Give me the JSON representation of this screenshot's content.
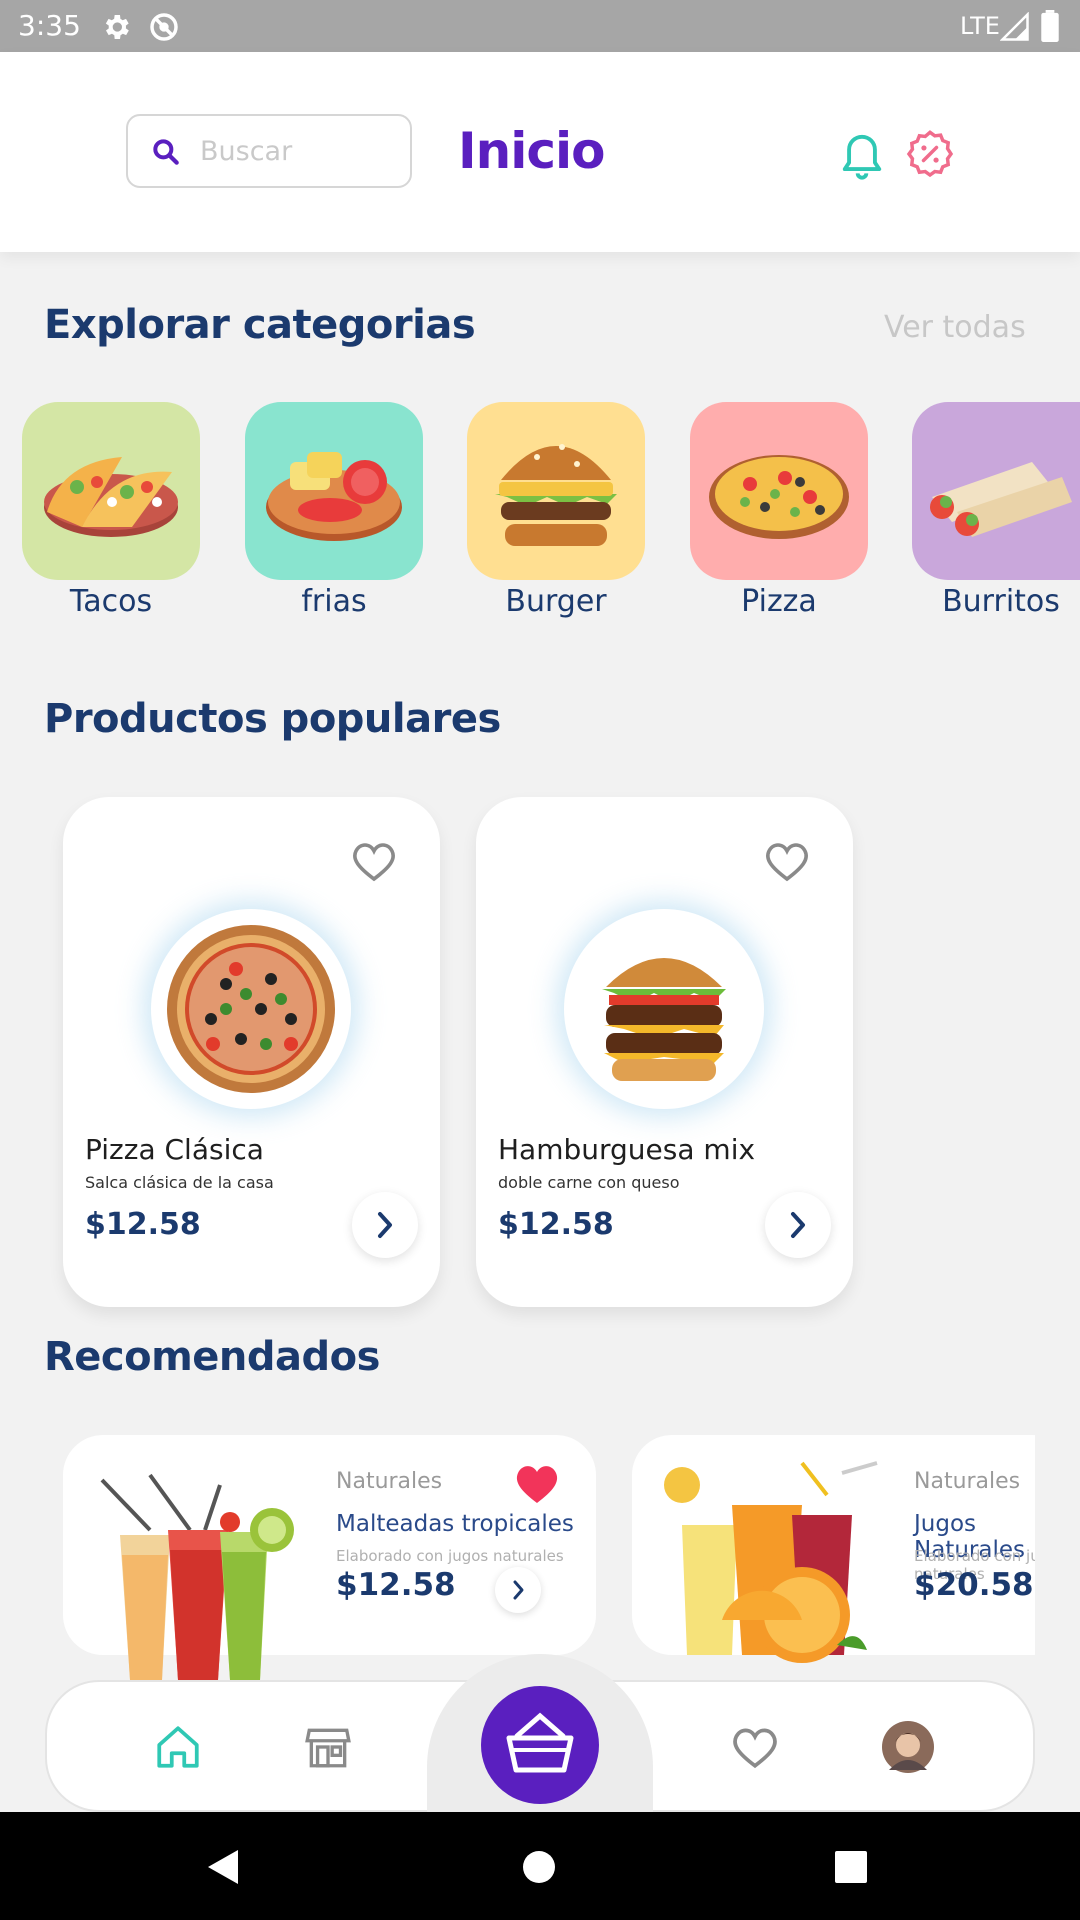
{
  "status_bar": {
    "time": "3:35",
    "network": "LTE"
  },
  "header": {
    "search_placeholder": "Buscar",
    "title": "Inicio"
  },
  "categories_section": {
    "title": "Explorar categorias",
    "see_all": "Ver todas",
    "items": [
      {
        "label": "Tacos",
        "bg": "#d4e6a5"
      },
      {
        "label": "frias",
        "bg": "#89e4cf"
      },
      {
        "label": "Burger",
        "bg": "#ffdf91"
      },
      {
        "label": "Pizza",
        "bg": "#ffadad"
      },
      {
        "label": "Burritos",
        "bg": "#c9a7db"
      }
    ]
  },
  "popular_section": {
    "title": "Productos populares",
    "items": [
      {
        "name": "Pizza Clásica",
        "description": "Salca clásica de la casa",
        "price": "$12.58"
      },
      {
        "name": "Hamburguesa mix",
        "description": "doble carne con queso",
        "price": "$12.58"
      }
    ]
  },
  "recommended_section": {
    "title": "Recomendados",
    "items": [
      {
        "category": "Naturales",
        "name": "Malteadas tropicales",
        "description": "Elaborado con jugos naturales",
        "price": "$12.58",
        "favorite": true
      },
      {
        "category": "Naturales",
        "name": "Jugos Naturales",
        "description": "Elaborado con jugos naturales",
        "price": "$20.58",
        "favorite": false
      }
    ]
  },
  "bottom_nav": {
    "items": [
      "home-icon",
      "store-icon",
      "basket-icon",
      "heart-icon",
      "avatar"
    ]
  },
  "colors": {
    "primary": "#5a1fbf",
    "accent_teal": "#2fc8b4",
    "accent_pink": "#f06c8c",
    "navy": "#1b3a6e",
    "fav_red": "#f2345a"
  }
}
